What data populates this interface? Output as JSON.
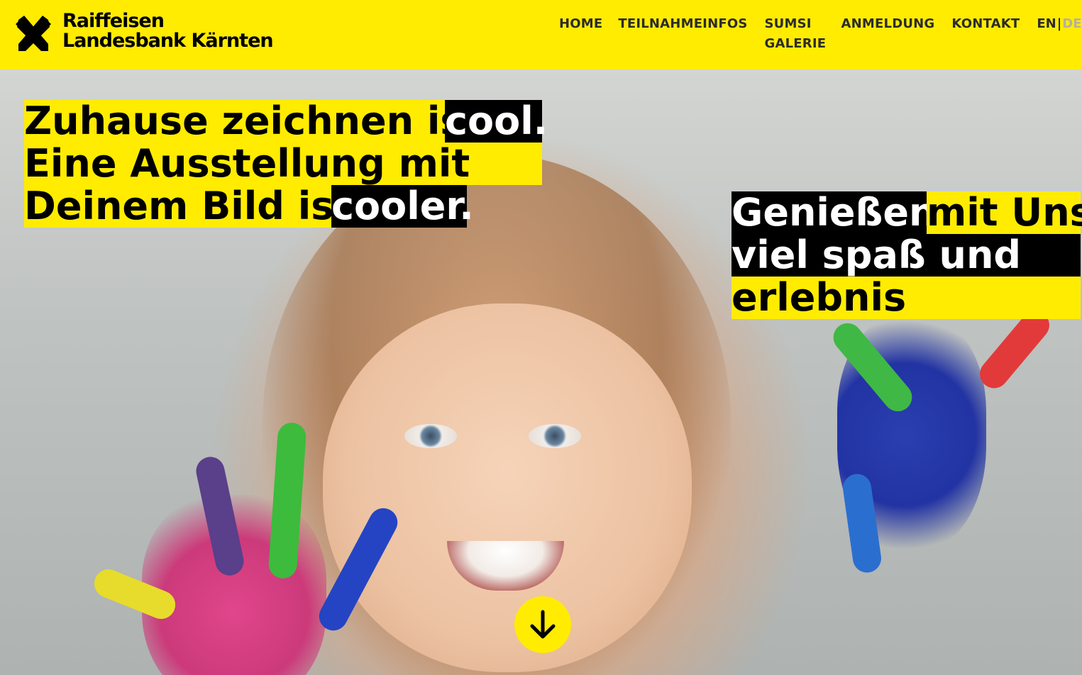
{
  "brand": {
    "line1": "Raiffeisen",
    "line2": "Landesbank Kärnten",
    "yellow": "#ffec00",
    "black": "#000000"
  },
  "nav": {
    "items": [
      {
        "label": "HOME"
      },
      {
        "label": "TEILNAHMEINFOS"
      },
      {
        "label": "SUMSI GALERIE"
      },
      {
        "label": "ANMELDUNG"
      },
      {
        "label": "KONTAKT"
      }
    ],
    "lang": {
      "en": "EN",
      "separator": "|",
      "de": "DE"
    }
  },
  "hero": {
    "left_headline": {
      "line1_a": "Zuhause zeichnen ist",
      "line1_b": "cool.",
      "line2": "Eine Ausstellung mit",
      "line3_a": "Deinem Bild ist",
      "line3_b": "cooler."
    },
    "right_headline": {
      "line1_a": "Genießen",
      "line1_b": "mit Uns",
      "line2": "viel spaß und",
      "line3": "erlebnis"
    },
    "scroll_icon": "arrow-down-icon"
  }
}
